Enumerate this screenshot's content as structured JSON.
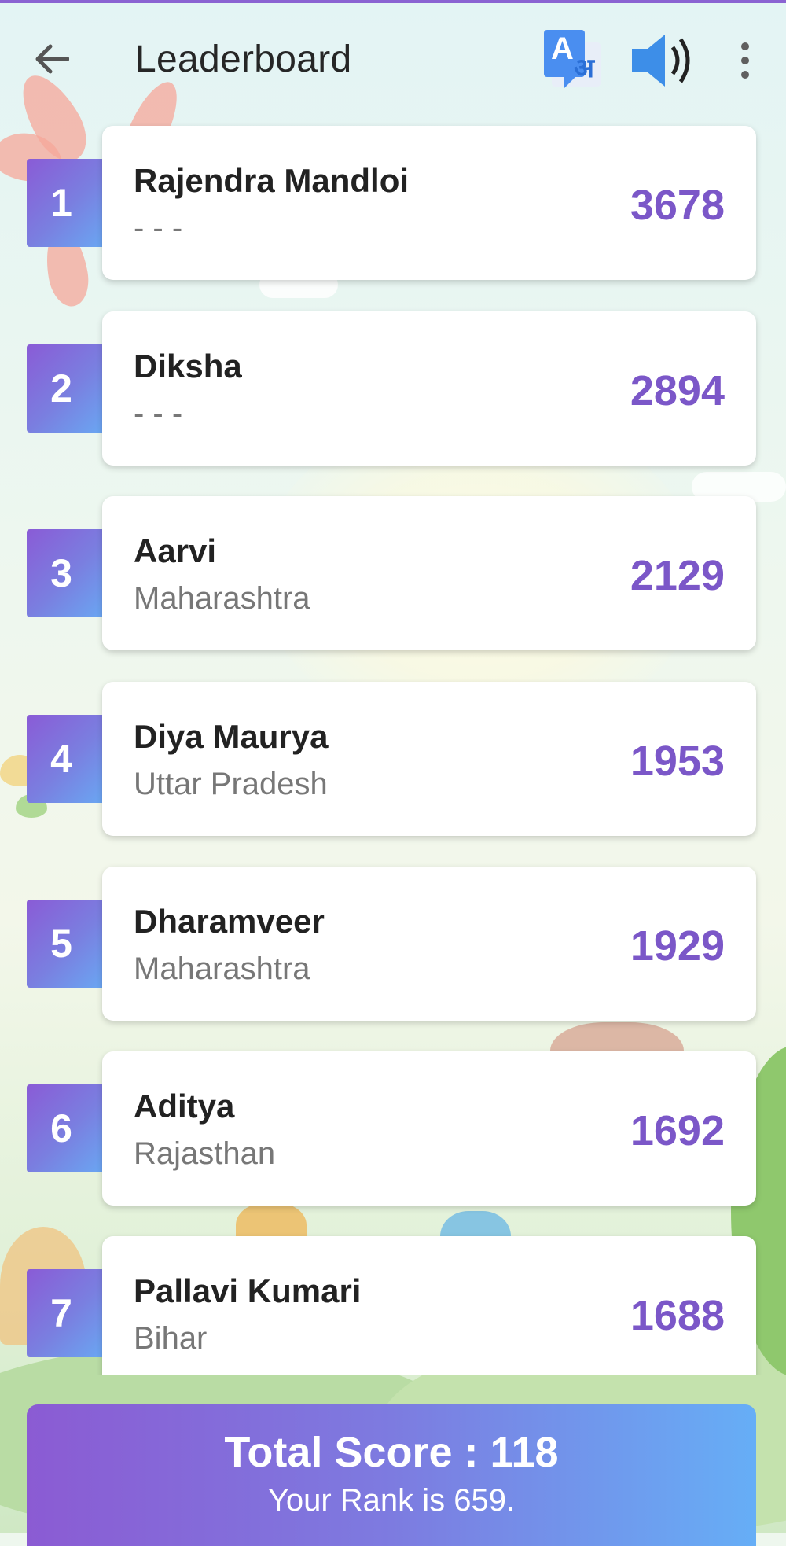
{
  "app_bar": {
    "title": "Leaderboard",
    "icons": [
      "back-arrow-icon",
      "translate-icon",
      "speaker-icon",
      "more-vertical-icon"
    ],
    "translate_glyph_latin": "A",
    "translate_glyph_hindi": "अ"
  },
  "leaderboard": [
    {
      "rank": "1",
      "name": "Rajendra Mandloi",
      "region": "- - -",
      "score": "3678"
    },
    {
      "rank": "2",
      "name": "Diksha",
      "region": "- - -",
      "score": "2894"
    },
    {
      "rank": "3",
      "name": "Aarvi",
      "region": "Maharashtra",
      "score": "2129"
    },
    {
      "rank": "4",
      "name": "Diya Maurya",
      "region": "Uttar Pradesh",
      "score": "1953"
    },
    {
      "rank": "5",
      "name": "Dharamveer",
      "region": "Maharashtra",
      "score": "1929"
    },
    {
      "rank": "6",
      "name": "Aditya",
      "region": "Rajasthan",
      "score": "1692"
    },
    {
      "rank": "7",
      "name": "Pallavi Kumari",
      "region": "Bihar",
      "score": "1688"
    }
  ],
  "summary": {
    "total_score": "Total Score : 118",
    "your_rank": "Your Rank is 659."
  },
  "colors": {
    "accent_purple": "#7b57c8",
    "gradient_start": "#8a5bd6",
    "gradient_end": "#66aef6",
    "translate_blue": "#4a8ef0",
    "speaker_blue": "#3d8ee8"
  }
}
